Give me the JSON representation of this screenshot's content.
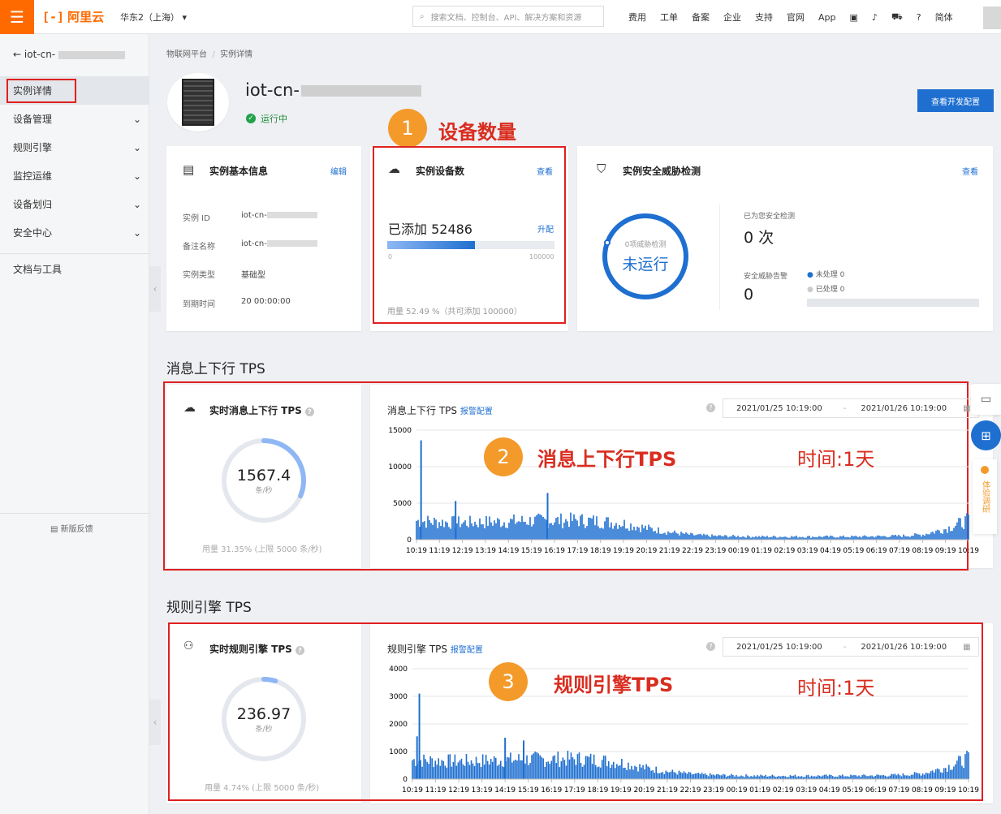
{
  "topbar": {
    "logo_text": "阿里云",
    "region": "华东2（上海）",
    "search_placeholder": "搜索文档、控制台、API、解决方案和资源",
    "links": [
      "费用",
      "工单",
      "备案",
      "企业",
      "支持",
      "官网",
      "App"
    ],
    "lang": "简体"
  },
  "sidebar": {
    "back_label": "iot-cn-",
    "items": [
      {
        "label": "实例详情",
        "has_chevron": false
      },
      {
        "label": "设备管理",
        "has_chevron": true
      },
      {
        "label": "规则引擎",
        "has_chevron": true
      },
      {
        "label": "监控运维",
        "has_chevron": true
      },
      {
        "label": "设备划归",
        "has_chevron": true
      },
      {
        "label": "安全中心",
        "has_chevron": true
      }
    ],
    "docs": "文档与工具",
    "feedback": "新版反馈"
  },
  "breadcrumb": {
    "root": "物联网平台",
    "sep": "/",
    "current": "实例详情"
  },
  "instance": {
    "name": "iot-cn-",
    "status": "运行中",
    "dev_config_button": "查看开发配置"
  },
  "basic_info": {
    "title": "实例基本信息",
    "edit": "编辑",
    "rows": [
      {
        "label": "实例 ID",
        "value": "iot-cn-"
      },
      {
        "label": "备注名称",
        "value": "iot-cn-"
      },
      {
        "label": "实例类型",
        "value": "基础型"
      },
      {
        "label": "到期时间",
        "value": "20   00:00:00"
      }
    ]
  },
  "devices": {
    "title": "实例设备数",
    "view": "查看",
    "added_label": "已添加 52486",
    "upgrade": "升配",
    "progress": 0.5249,
    "min": "0",
    "max": "100000",
    "usage": "用量 52.49 %（共可添加 100000）"
  },
  "security": {
    "title": "实例安全威胁检测",
    "view": "查看",
    "ring_sub": "0项威胁检测",
    "ring_main": "未运行",
    "checked_label": "已为您安全检测",
    "checked_value": "0 次",
    "alerts_label": "安全威胁告警",
    "alerts_value": "0",
    "unhandled": "未处理  0",
    "handled": "已处理  0"
  },
  "annotations": {
    "a1": {
      "num": "1",
      "text": "设备数量"
    },
    "a2": {
      "num": "2",
      "text": "消息上下行TPS",
      "time": "时间:1天"
    },
    "a3": {
      "num": "3",
      "text": "规则引擎TPS",
      "time": "时间:1天"
    }
  },
  "msg_section": {
    "title": "消息上下行 TPS",
    "rt_title": "实时消息上下行 TPS",
    "rt_value": "1567.4",
    "rt_unit": "条/秒",
    "rt_fraction": 0.3135,
    "rt_usage": "用量 31.35% (上限 5000 条/秒)",
    "chart_title": "消息上下行 TPS",
    "alarm_link": "报警配置",
    "start": "2021/01/25 10:19:00",
    "end": "2021/01/26 10:19:00",
    "dash": "-"
  },
  "rule_section": {
    "title": "规则引擎 TPS",
    "rt_title": "实时规则引擎 TPS",
    "rt_value": "236.97",
    "rt_unit": "条/秒",
    "rt_fraction": 0.0474,
    "rt_usage": "用量 4.74% (上限 5000 条/秒)",
    "chart_title": "规则引擎 TPS",
    "alarm_link": "报警配置",
    "start": "2021/01/25 10:19:00",
    "end": "2021/01/26 10:19:00",
    "dash": "-"
  },
  "float_panel": {
    "label": "体验调研"
  },
  "chart_data": [
    {
      "type": "area",
      "title": "消息上下行 TPS",
      "x": [
        "10:19",
        "11:19",
        "12:19",
        "13:19",
        "14:19",
        "15:19",
        "16:19",
        "17:19",
        "18:19",
        "19:19",
        "20:19",
        "21:19",
        "22:19",
        "23:19",
        "00:19",
        "01:19",
        "02:19",
        "03:19",
        "04:19",
        "05:19",
        "06:19",
        "07:19",
        "08:19",
        "09:19",
        "10:19"
      ],
      "values": [
        2800,
        2600,
        2500,
        2600,
        2700,
        2800,
        2800,
        2900,
        2700,
        2400,
        1700,
        1100,
        700,
        550,
        500,
        450,
        450,
        450,
        450,
        450,
        500,
        550,
        750,
        1600,
        2900
      ],
      "peaks": [
        [
          0.2,
          13600
        ],
        [
          1.7,
          5300
        ],
        [
          5.7,
          6400
        ]
      ],
      "yticks": [
        0,
        5000,
        10000,
        15000
      ],
      "ylim": [
        0,
        15000
      ]
    },
    {
      "type": "area",
      "title": "规则引擎 TPS",
      "x": [
        "10:19",
        "11:19",
        "12:19",
        "13:19",
        "14:19",
        "15:19",
        "16:19",
        "17:19",
        "18:19",
        "19:19",
        "20:19",
        "21:19",
        "22:19",
        "23:19",
        "00:19",
        "01:19",
        "02:19",
        "03:19",
        "04:19",
        "05:19",
        "06:19",
        "07:19",
        "08:19",
        "09:19",
        "10:19"
      ],
      "values": [
        750,
        720,
        700,
        720,
        750,
        780,
        780,
        800,
        750,
        650,
        450,
        300,
        200,
        160,
        140,
        130,
        130,
        130,
        130,
        130,
        140,
        160,
        220,
        450,
        820
      ],
      "peaks": [
        [
          0.3,
          3100
        ],
        [
          0.2,
          1550
        ],
        [
          4.0,
          1500
        ],
        [
          4.8,
          1400
        ]
      ],
      "yticks": [
        0,
        1000,
        2000,
        3000,
        4000
      ],
      "ylim": [
        0,
        4000
      ]
    }
  ]
}
